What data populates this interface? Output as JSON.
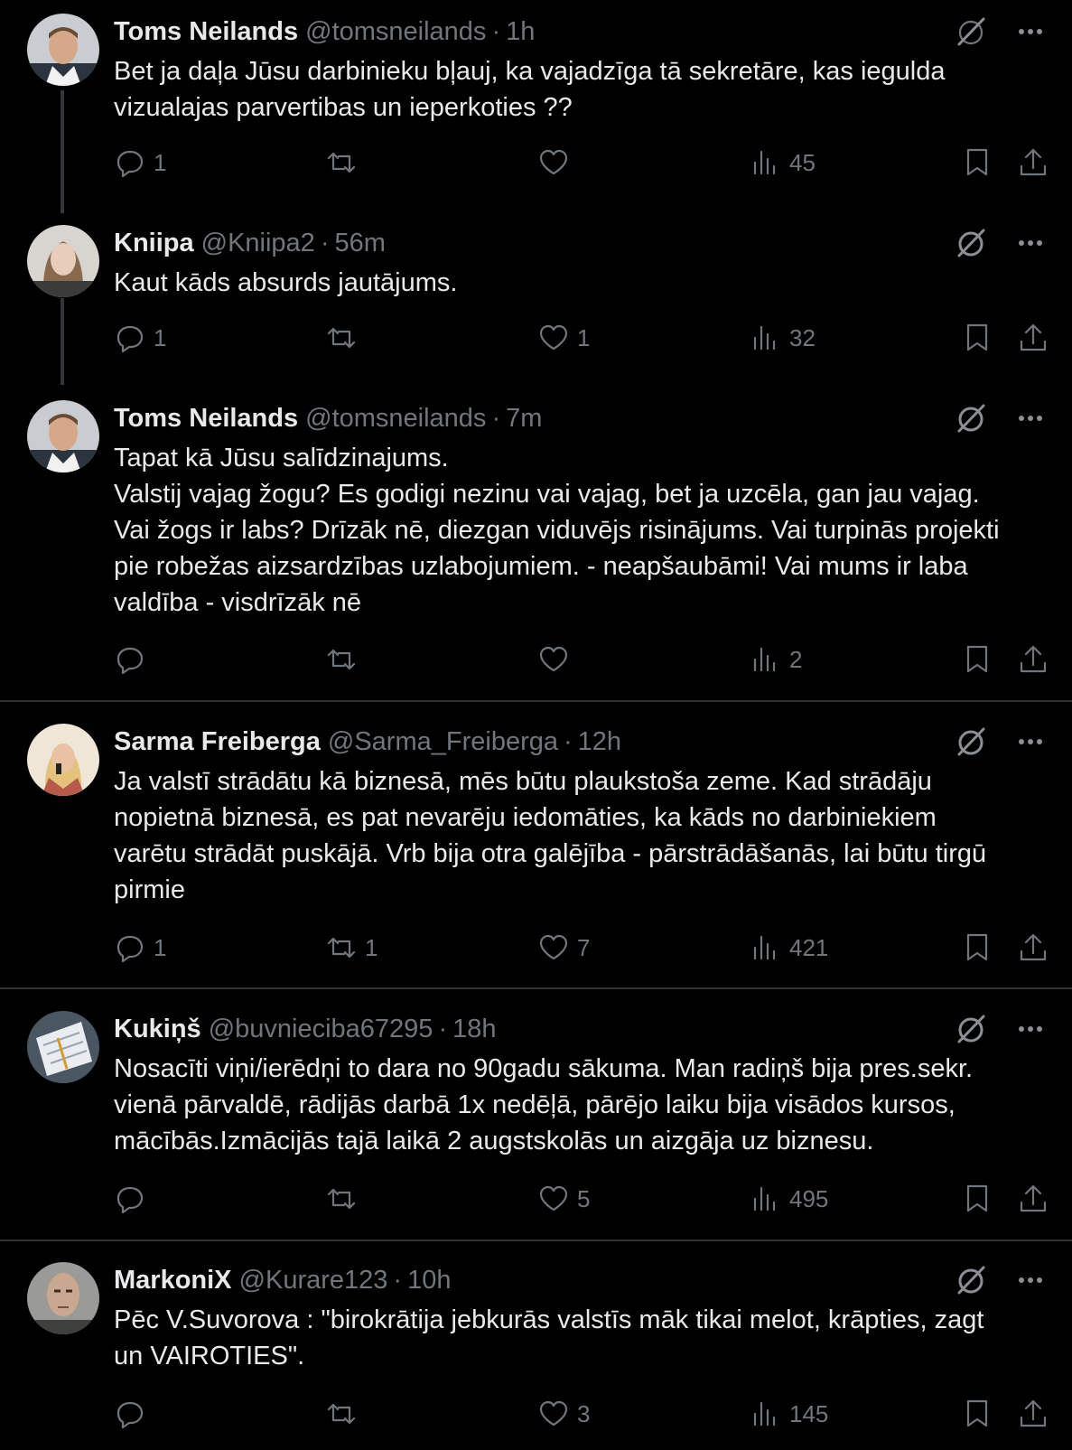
{
  "tweets": [
    {
      "name": "Toms Neilands",
      "handle": "@tomsneilands",
      "time": "1h",
      "lines": [
        "Bet ja daļa Jūsu darbinieku bļauj, ka vajadzīga tā sekretāre, kas iegulda",
        "vizualajas parvertibas un ieperkoties ??"
      ],
      "replies": "1",
      "reposts": "",
      "likes": "",
      "views": "45"
    },
    {
      "name": "Kniipa",
      "handle": "@Kniipa2",
      "time": "56m",
      "lines": [
        "Kaut kāds absurds jautājums."
      ],
      "replies": "1",
      "reposts": "",
      "likes": "1",
      "views": "32"
    },
    {
      "name": "Toms Neilands",
      "handle": "@tomsneilands",
      "time": "7m",
      "lines": [
        "Tapat kā Jūsu salīdzinajums.",
        "Valstij vajag žogu? Es godigi nezinu vai vajag, bet ja uzcēla, gan jau vajag.",
        "Vai žogs ir labs? Drīzāk nē, diezgan viduvējs risinājums. Vai turpinās projekti",
        "pie robežas aizsardzības uzlabojumiem. - neapšaubāmi! Vai mums ir laba",
        "valdība - visdrīzāk nē"
      ],
      "replies": "",
      "reposts": "",
      "likes": "",
      "views": "2"
    },
    {
      "name": "Sarma Freiberga",
      "handle": "@Sarma_Freiberga",
      "time": "12h",
      "lines": [
        "Ja valstī strādātu kā biznesā, mēs būtu plaukstoša zeme. Kad strādāju",
        "nopietnā biznesā, es pat nevarēju iedomāties, ka kāds no darbiniekiem",
        "varētu strādāt puskājā. Vrb bija otra galējība - pārstrādāšanās, lai būtu tirgū",
        "pirmie"
      ],
      "replies": "1",
      "reposts": "1",
      "likes": "7",
      "views": "421"
    },
    {
      "name": "Kukiņš",
      "handle": "@buvnieciba67295",
      "time": "18h",
      "lines": [
        "Nosacīti viņi/ierēdņi to dara no 90gadu sākuma. Man radiņš bija pres.sekr.",
        "vienā pārvaldē, rādijās darbā 1x nedēļā, pārējo laiku bija visādos kursos,",
        "mācībās.Izmācijās tajā laikā 2 augstskolās un aizgāja uz biznesu."
      ],
      "replies": "",
      "reposts": "",
      "likes": "5",
      "views": "495"
    },
    {
      "name": "MarkoniX",
      "handle": "@Kurare123",
      "time": "10h",
      "lines": [
        "Pēc V.Suvorova : \"birokrātija jebkurās valstīs māk tikai melot, krāpties, zagt",
        "un VAIROTIES\"."
      ],
      "replies": "",
      "reposts": "",
      "likes": "3",
      "views": "145"
    }
  ],
  "separator": "·",
  "colors": {
    "background": "#000000",
    "text": "#e7e9ea",
    "muted": "#71767b",
    "divider": "#2f3336"
  },
  "icons": [
    "grok-icon",
    "more-icon",
    "reply-icon",
    "repost-icon",
    "like-icon",
    "views-icon",
    "bookmark-icon",
    "share-icon"
  ]
}
